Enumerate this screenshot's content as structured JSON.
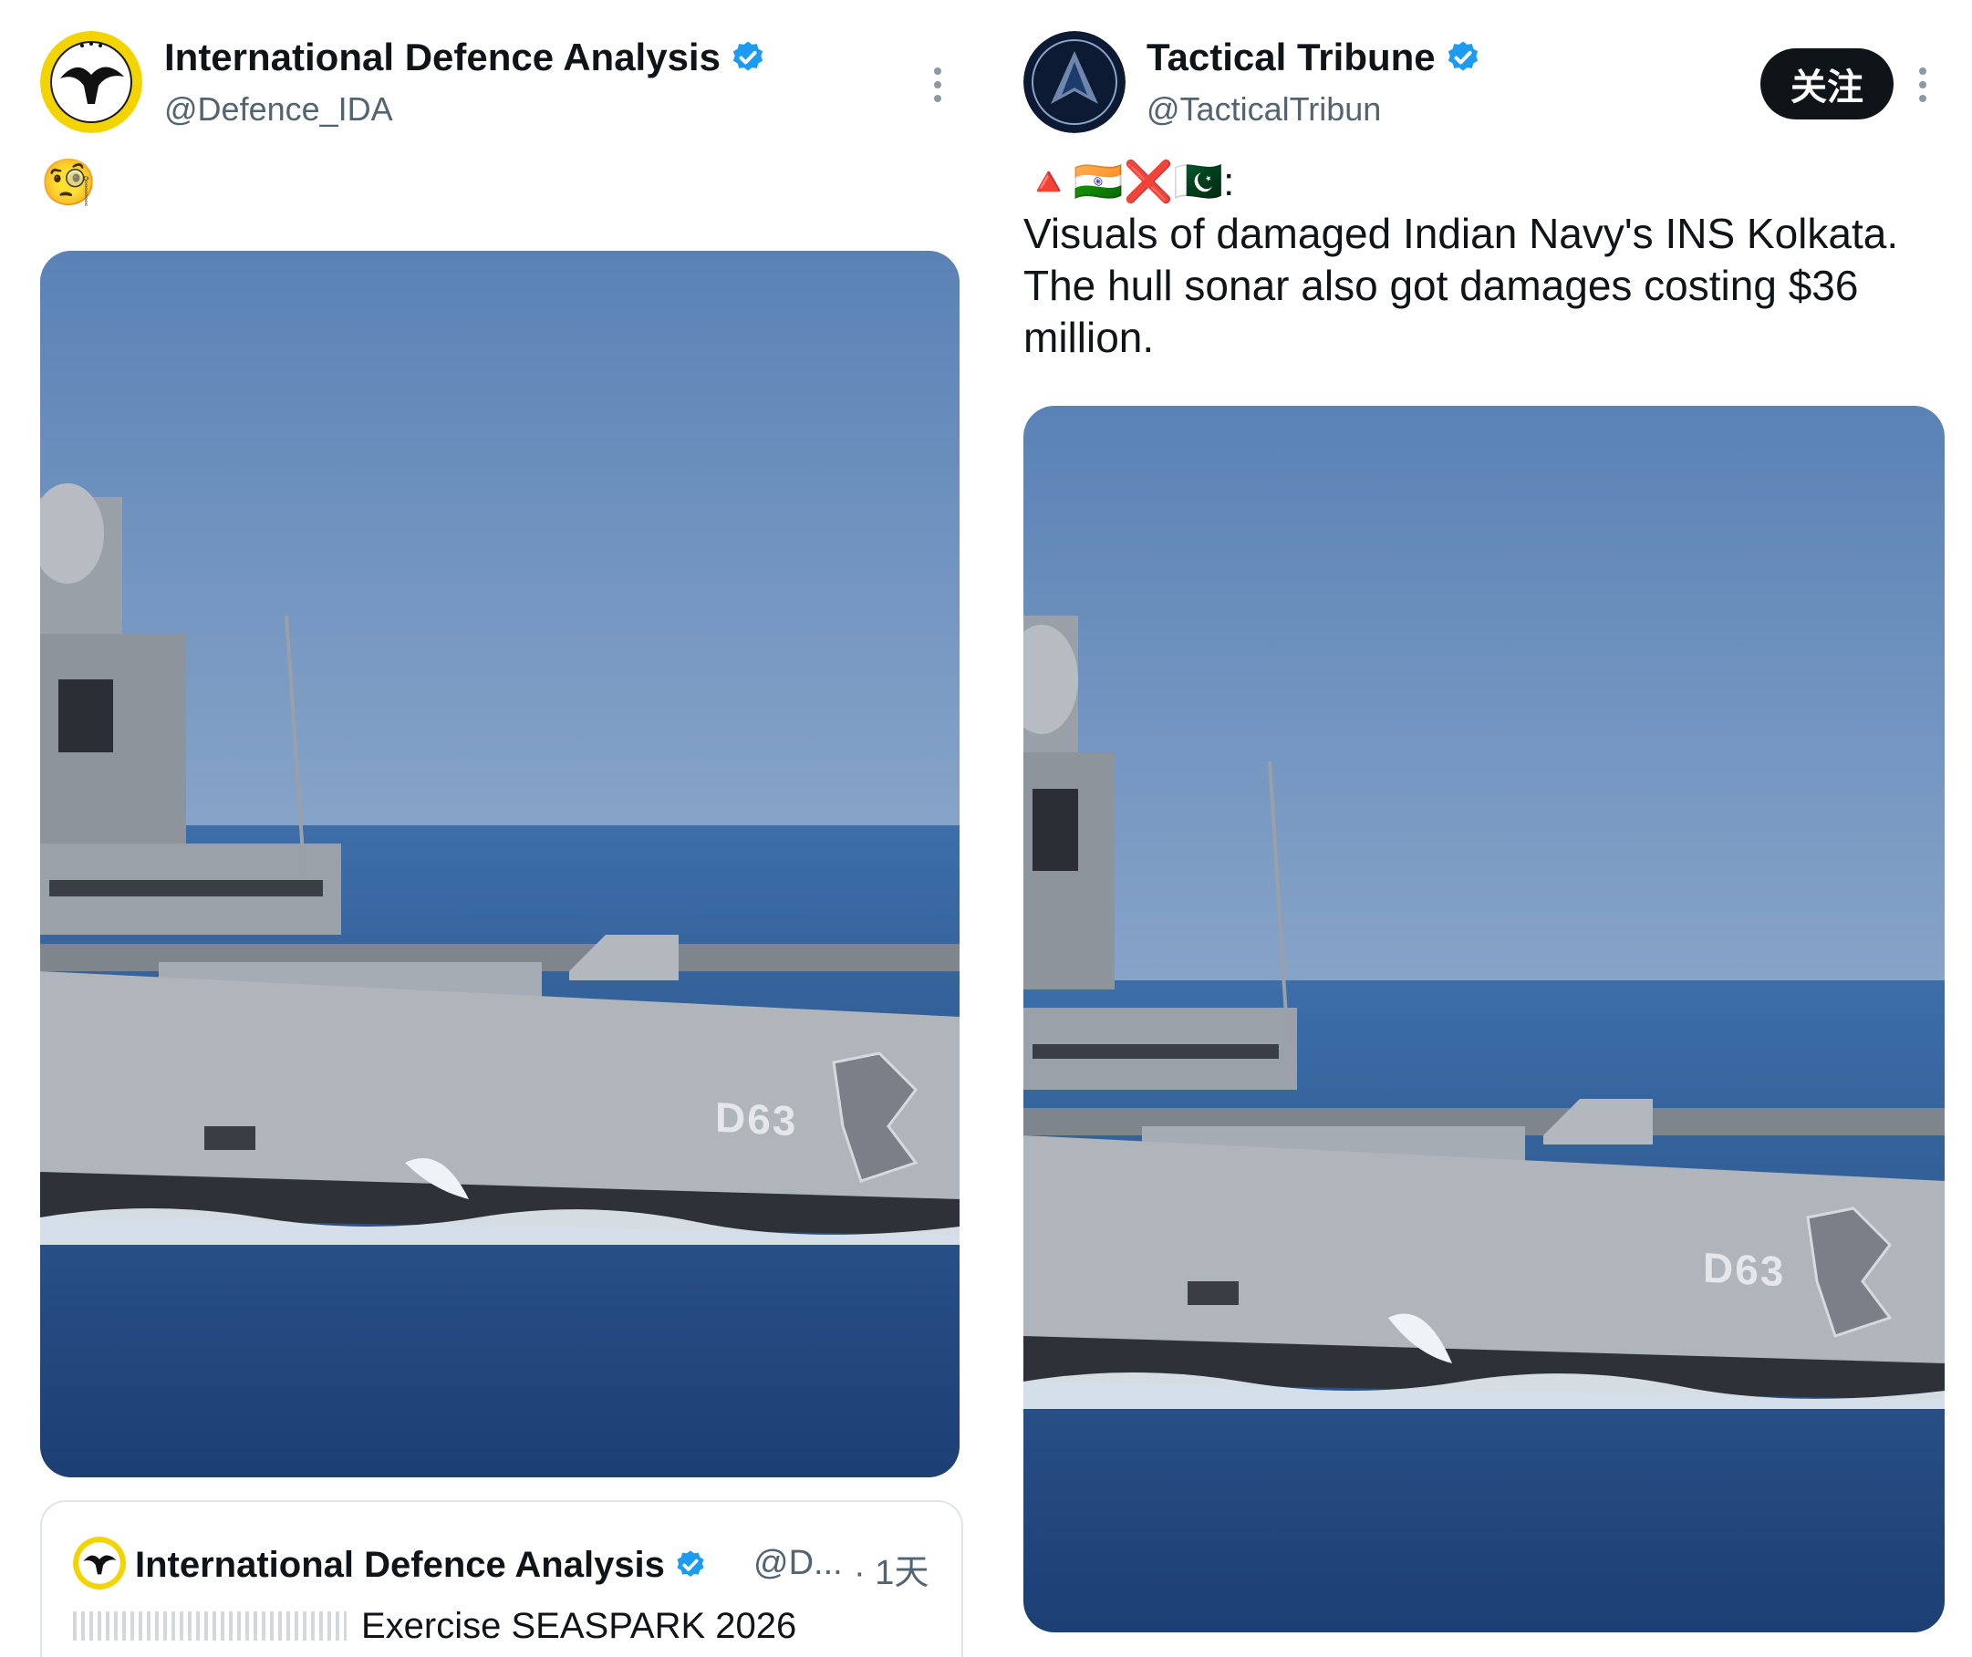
{
  "left_post": {
    "author_name": "International Defence Analysis",
    "handle": "@Defence_IDA",
    "emoji": "🧐",
    "quote": {
      "author_name": "International Defence Analysis",
      "handle_truncated": "@D...",
      "time": "· 1天",
      "text": "Exercise SEASPARK 2026"
    }
  },
  "right_post": {
    "author_name": "Tactical Tribune",
    "handle": "@TacticalTribun",
    "follow_label": "关注",
    "emoji_prefix": "🔺🇮🇳❌🇵🇰:",
    "text": "Visuals of damaged Indian Navy's INS Kolkata. The hull sonar also got damages costing $36 million."
  },
  "hull_number": "D63",
  "colors": {
    "verified": "#1d9bf0",
    "sky": "#5f86b8",
    "sea": "#214c82",
    "hull": "#a9adb3"
  }
}
